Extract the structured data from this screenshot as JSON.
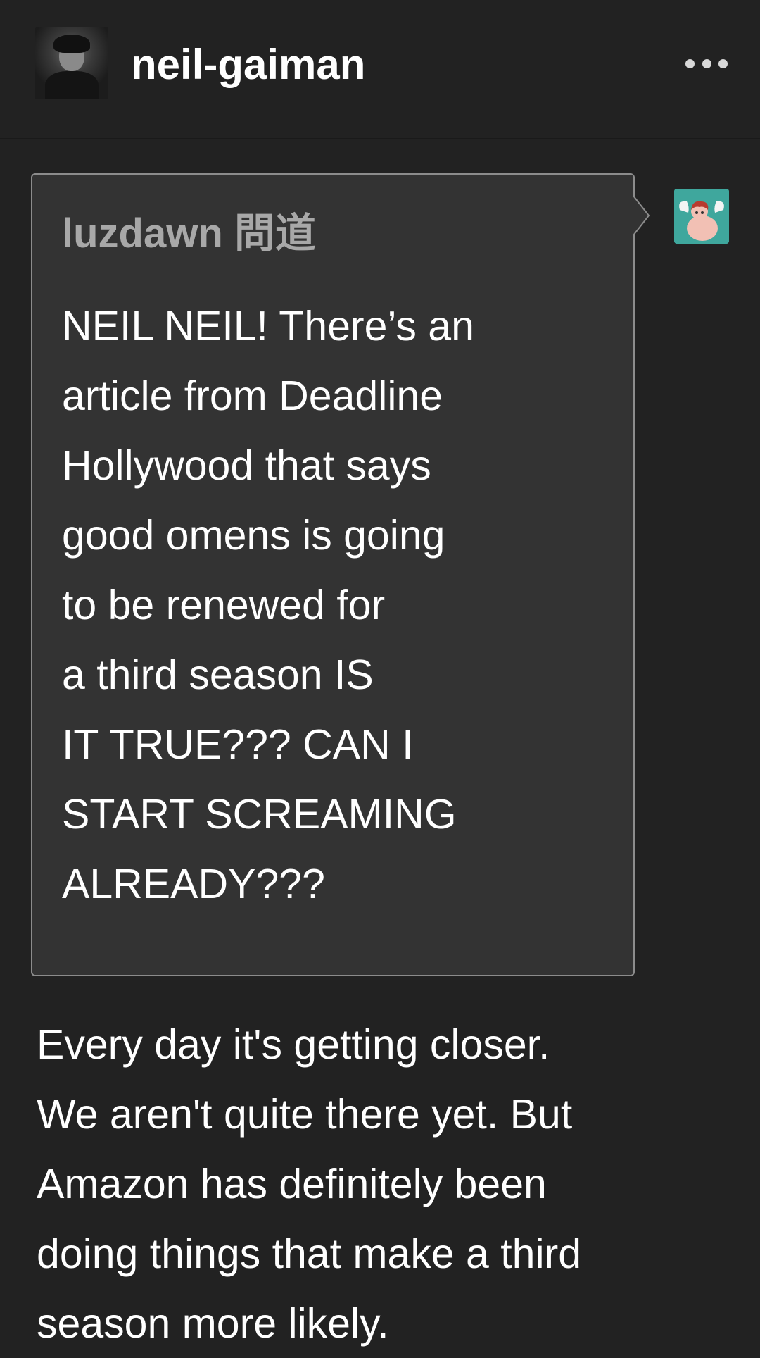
{
  "header": {
    "blog_name": "neil-gaiman",
    "avatar_icon": "author-portrait",
    "more_icon": "more-horizontal-icon"
  },
  "ask": {
    "asker": "luzdawn 問道",
    "asker_avatar_icon": "cherub-avatar",
    "lines": [
      "NEIL NEIL! There’s an",
      "article from Deadline",
      "Hollywood that says",
      "good omens is going",
      "to be renewed for",
      "a third season IS",
      "IT TRUE??? CAN I",
      "START SCREAMING",
      "ALREADY???"
    ]
  },
  "answer": {
    "lines": [
      "Every day it's getting closer.",
      "We aren't quite there yet. But",
      "Amazon has definitely been",
      "doing things that make a third",
      "season more likely."
    ]
  },
  "colors": {
    "background": "#222222",
    "ask_box_bg": "#333333",
    "ask_box_border": "#8c8c8c",
    "asker_name": "#a8a8a8",
    "text": "#ffffff",
    "asker_avatar_bg": "#3fa79d"
  }
}
